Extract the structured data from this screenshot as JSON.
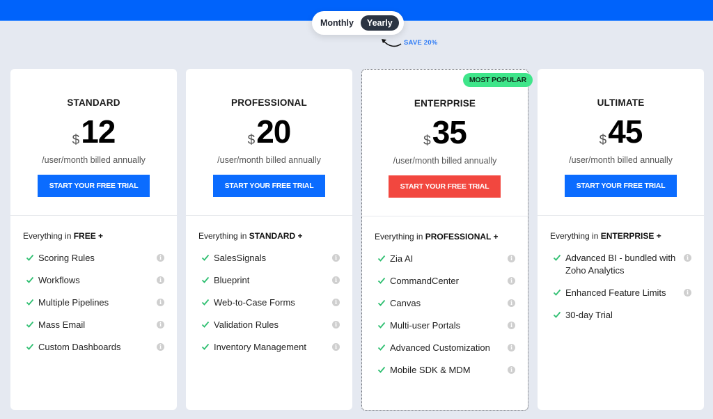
{
  "billing_toggle": {
    "options": [
      "Monthly",
      "Yearly"
    ],
    "selected": "Yearly",
    "save_note": "SAVE 20%"
  },
  "colors": {
    "brand_blue": "#0063fb",
    "cta_blue": "#0b6cff",
    "cta_red": "#f2473f",
    "badge_green": "#3fe58a",
    "check_green": "#2fbf71"
  },
  "plans": [
    {
      "name": "STANDARD",
      "currency": "$",
      "price": "12",
      "billing": "/user/month billed annually",
      "cta": "START YOUR FREE TRIAL",
      "includes_prefix": "Everything in ",
      "includes_plan": "FREE +",
      "features": [
        {
          "label": "Scoring Rules",
          "info": true
        },
        {
          "label": "Workflows",
          "info": true
        },
        {
          "label": "Multiple Pipelines",
          "info": true
        },
        {
          "label": "Mass Email",
          "info": true
        },
        {
          "label": "Custom Dashboards",
          "info": true
        }
      ]
    },
    {
      "name": "PROFESSIONAL",
      "currency": "$",
      "price": "20",
      "billing": "/user/month billed annually",
      "cta": "START YOUR FREE TRIAL",
      "includes_prefix": "Everything in ",
      "includes_plan": "STANDARD +",
      "features": [
        {
          "label": "SalesSignals",
          "info": true
        },
        {
          "label": "Blueprint",
          "info": true
        },
        {
          "label": "Web-to-Case Forms",
          "info": true
        },
        {
          "label": "Validation Rules",
          "info": true
        },
        {
          "label": "Inventory Management",
          "info": true
        }
      ]
    },
    {
      "name": "ENTERPRISE",
      "badge": "MOST POPULAR",
      "currency": "$",
      "price": "35",
      "billing": "/user/month billed annually",
      "cta": "START YOUR FREE TRIAL",
      "includes_prefix": "Everything in ",
      "includes_plan": "PROFESSIONAL +",
      "features": [
        {
          "label": "Zia AI",
          "info": true
        },
        {
          "label": "CommandCenter",
          "info": true
        },
        {
          "label": "Canvas",
          "info": true
        },
        {
          "label": "Multi-user Portals",
          "info": true
        },
        {
          "label": "Advanced Customization",
          "info": true
        },
        {
          "label": "Mobile SDK & MDM",
          "info": true
        }
      ]
    },
    {
      "name": "ULTIMATE",
      "currency": "$",
      "price": "45",
      "billing": "/user/month billed annually",
      "cta": "START YOUR FREE TRIAL",
      "includes_prefix": "Everything in ",
      "includes_plan": "ENTERPRISE +",
      "features": [
        {
          "label": "Advanced BI - bundled with Zoho Analytics",
          "info": true
        },
        {
          "label": "Enhanced Feature Limits",
          "info": true
        },
        {
          "label": "30-day Trial",
          "info": false
        }
      ]
    }
  ]
}
